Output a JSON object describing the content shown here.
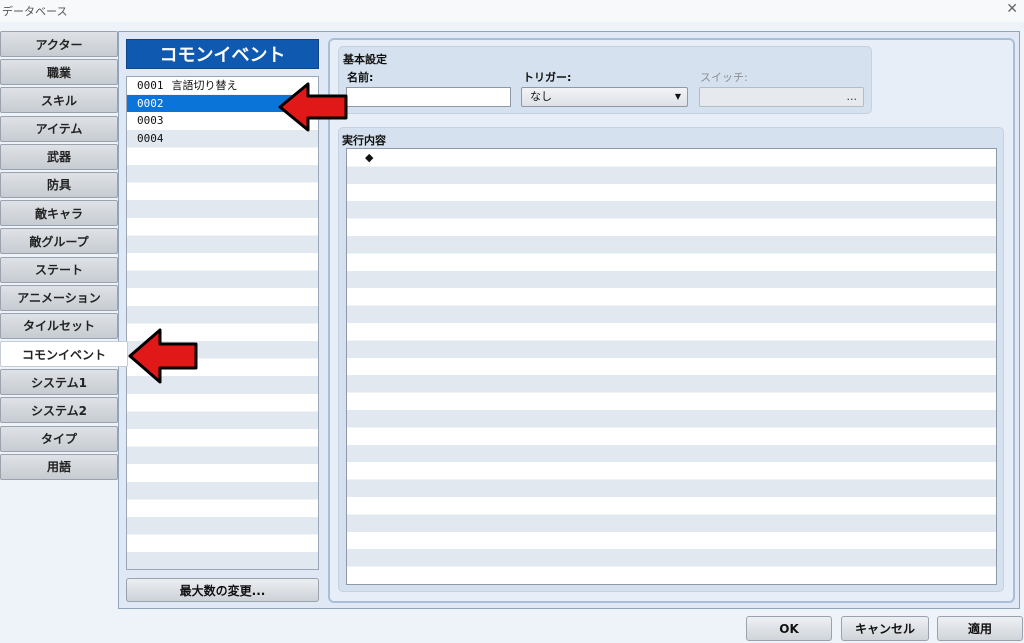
{
  "window": {
    "title": "データベース",
    "close_symbol": "✕"
  },
  "tabs": [
    {
      "label": "アクター",
      "active": false
    },
    {
      "label": "職業",
      "active": false
    },
    {
      "label": "スキル",
      "active": false
    },
    {
      "label": "アイテム",
      "active": false
    },
    {
      "label": "武器",
      "active": false
    },
    {
      "label": "防具",
      "active": false
    },
    {
      "label": "敵キャラ",
      "active": false
    },
    {
      "label": "敵グループ",
      "active": false
    },
    {
      "label": "ステート",
      "active": false
    },
    {
      "label": "アニメーション",
      "active": false
    },
    {
      "label": "タイルセット",
      "active": false
    },
    {
      "label": "コモンイベント",
      "active": true
    },
    {
      "label": "システム1",
      "active": false
    },
    {
      "label": "システム2",
      "active": false
    },
    {
      "label": "タイプ",
      "active": false
    },
    {
      "label": "用語",
      "active": false
    }
  ],
  "list": {
    "header": "コモンイベント",
    "items": [
      {
        "id": "0001",
        "name": "言語切り替え",
        "selected": false
      },
      {
        "id": "0002",
        "name": "",
        "selected": true
      },
      {
        "id": "0003",
        "name": "",
        "selected": false
      },
      {
        "id": "0004",
        "name": "",
        "selected": false
      }
    ],
    "max_button": "最大数の変更..."
  },
  "basic": {
    "section_title": "基本設定",
    "name_label": "名前:",
    "name_value": "",
    "trigger_label": "トリガー:",
    "trigger_value": "なし",
    "switch_label": "スイッチ:",
    "switch_button": "..."
  },
  "exec": {
    "section_title": "実行内容",
    "first_command": "◆"
  },
  "buttons": {
    "ok": "OK",
    "cancel": "キャンセル",
    "apply": "適用"
  },
  "colors": {
    "list_header": "#0f5ab0",
    "selection": "#0b74d8",
    "annotation_arrow": "#e01818"
  }
}
